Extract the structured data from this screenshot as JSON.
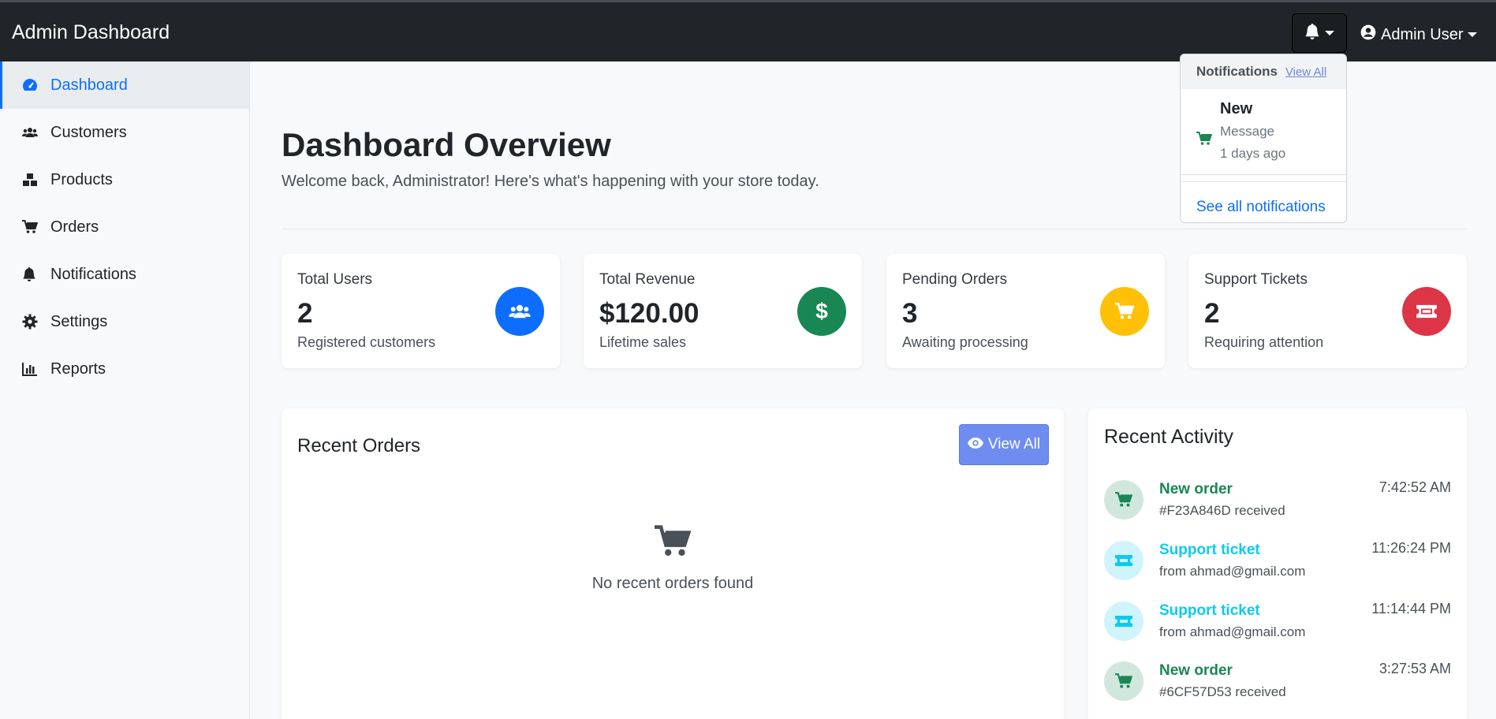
{
  "header": {
    "brand": "Admin Dashboard",
    "user_label": "Admin User"
  },
  "sidebar": {
    "items": [
      {
        "label": "Dashboard",
        "icon": "speedometer-icon",
        "active": true
      },
      {
        "label": "Customers",
        "icon": "users-icon"
      },
      {
        "label": "Products",
        "icon": "boxes-icon"
      },
      {
        "label": "Orders",
        "icon": "cart-icon"
      },
      {
        "label": "Notifications",
        "icon": "bell-icon"
      },
      {
        "label": "Settings",
        "icon": "gear-icon"
      },
      {
        "label": "Reports",
        "icon": "bar-chart-icon"
      }
    ]
  },
  "page": {
    "title": "Dashboard Overview",
    "subtitle": "Welcome back, Administrator! Here's what's happening with your store today."
  },
  "stats": [
    {
      "title": "Total Users",
      "value": "2",
      "desc": "Registered customers",
      "icon": "users-icon",
      "color": "#0d6efd"
    },
    {
      "title": "Total Revenue",
      "value": "$120.00",
      "desc": "Lifetime sales",
      "icon": "dollar-icon",
      "color": "#198754"
    },
    {
      "title": "Pending Orders",
      "value": "3",
      "desc": "Awaiting processing",
      "icon": "cart-icon",
      "color": "#ffc107"
    },
    {
      "title": "Support Tickets",
      "value": "2",
      "desc": "Requiring attention",
      "icon": "ticket-icon",
      "color": "#dc3545"
    }
  ],
  "recent_orders": {
    "title": "Recent Orders",
    "view_all_label": "View All",
    "empty_text": "No recent orders found"
  },
  "recent_activity": {
    "title": "Recent Activity",
    "items": [
      {
        "title": "New order",
        "desc": "#F23A846D received",
        "time": "7:42:52 AM",
        "type": "order"
      },
      {
        "title": "Support ticket",
        "desc": "from ahmad@gmail.com",
        "time": "11:26:24 PM",
        "type": "ticket"
      },
      {
        "title": "Support ticket",
        "desc": "from ahmad@gmail.com",
        "time": "11:14:44 PM",
        "type": "ticket"
      },
      {
        "title": "New order",
        "desc": "#6CF57D53 received",
        "time": "3:27:53 AM",
        "type": "order"
      }
    ]
  },
  "notifications": {
    "header": "Notifications",
    "view_all": "View All",
    "item": {
      "title": "New",
      "message": "Message",
      "time": "1 days ago"
    },
    "footer": "See all notifications"
  },
  "colors": {
    "order_green": "#198754",
    "ticket_cyan": "#0dcaf0",
    "primary": "#0d6efd"
  }
}
